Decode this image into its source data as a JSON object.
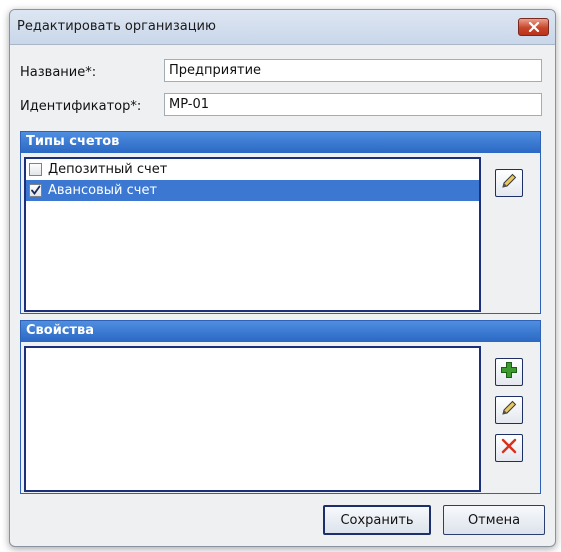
{
  "window": {
    "title": "Редактировать организацию"
  },
  "form": {
    "name_label": "Название*:",
    "name_value": "Предприятие",
    "id_label": "Идентификатор*:",
    "id_value": "MP-01"
  },
  "account_types": {
    "header": "Типы счетов",
    "items": [
      {
        "label": "Депозитный счет",
        "checked": false,
        "selected": false
      },
      {
        "label": "Авансовый счет",
        "checked": true,
        "selected": true
      }
    ]
  },
  "properties": {
    "header": "Свойства",
    "items": []
  },
  "buttons": {
    "save": "Сохранить",
    "cancel": "Отмена"
  },
  "icons": {
    "close": "close-icon",
    "edit": "pencil-icon",
    "add": "plus-icon",
    "delete": "delete-x-icon"
  },
  "colors": {
    "group_header": "#2a68c4",
    "selection": "#3c78d2",
    "add_green": "#3c9a2e",
    "delete_red": "#d8321e"
  }
}
